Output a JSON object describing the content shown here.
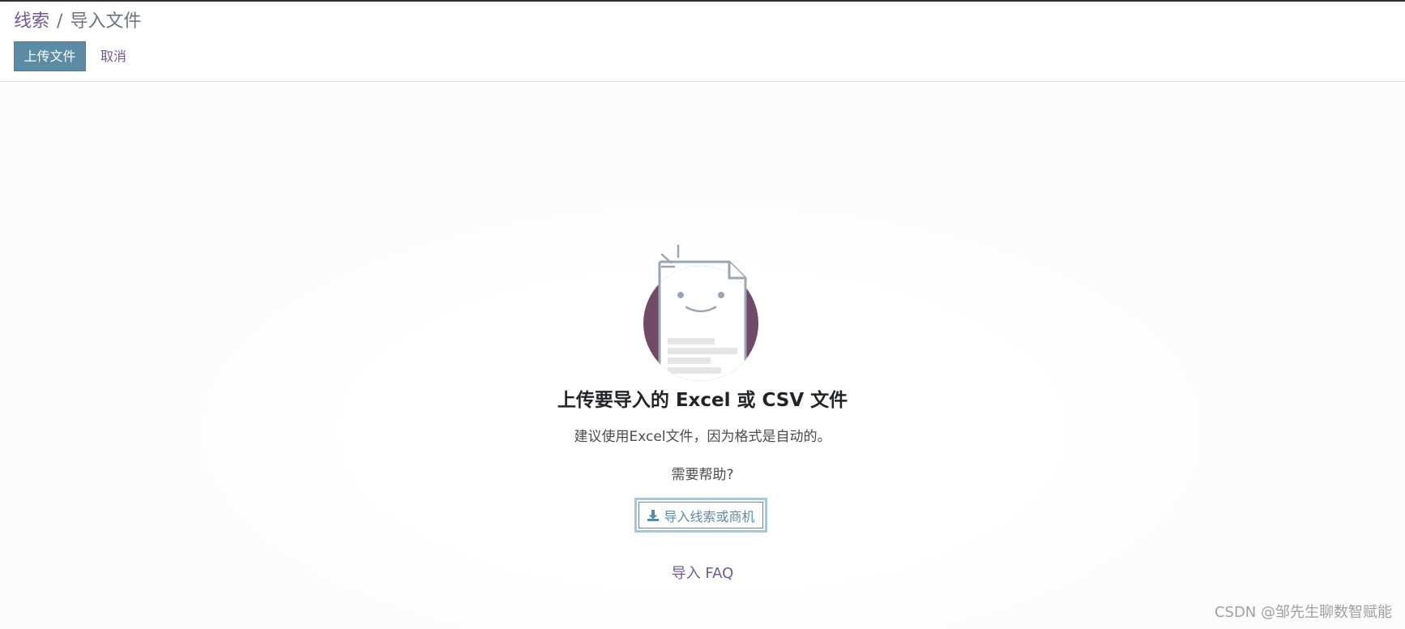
{
  "breadcrumb": {
    "parent": "线索",
    "separator": "/",
    "current": "导入文件"
  },
  "toolbar": {
    "upload_label": "上传文件",
    "cancel_label": "取消"
  },
  "main": {
    "title": "上传要导入的 Excel 或 CSV 文件",
    "subtitle": "建议使用Excel文件，因为格式是自动的。",
    "help_text": "需要帮助?",
    "import_template_button": "导入线索或商机",
    "faq_link": "导入 FAQ"
  },
  "watermark": "CSDN @邹先生聊数智赋能",
  "colors": {
    "primary": "#5b8ba5",
    "link": "#6e5b8f",
    "illustration_circle": "#6f4b68"
  },
  "icons": {
    "import_button_icon": "download-icon",
    "illustration": "smiling-document-icon"
  }
}
